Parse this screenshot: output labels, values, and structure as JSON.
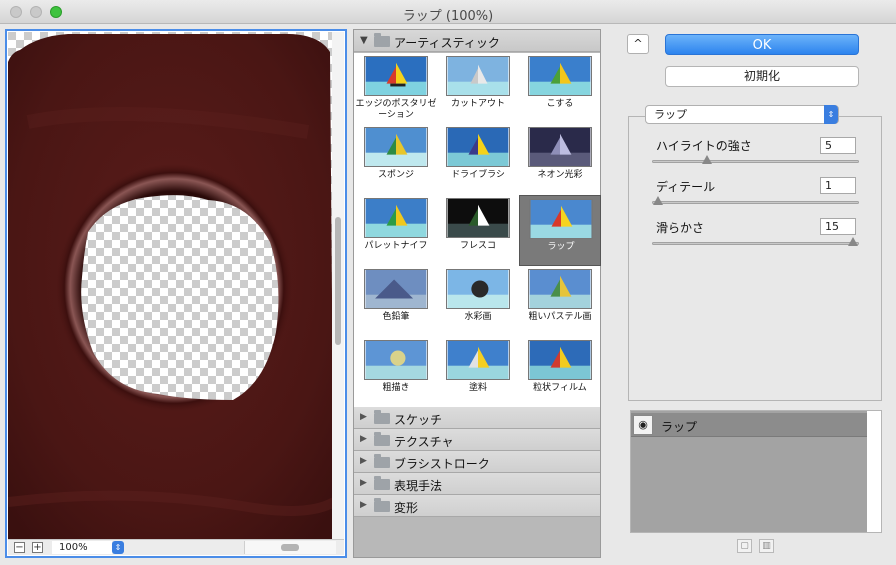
{
  "window": {
    "title": "ラップ (100%)"
  },
  "preview": {
    "zoom": "100%",
    "zoom_out": "−",
    "zoom_in": "+"
  },
  "gallery": {
    "open_group": "アーティスティック",
    "filters": [
      [
        "エッジのポスタリゼーション",
        "カットアウト",
        "こする"
      ],
      [
        "スポンジ",
        "ドライブラシ",
        "ネオン光彩"
      ],
      [
        "パレットナイフ",
        "フレスコ",
        "ラップ"
      ],
      [
        "色鉛筆",
        "水彩画",
        "粗いパステル画"
      ],
      [
        "粗描き",
        "塗料",
        "粒状フィルム"
      ]
    ],
    "selected_filter": "ラップ",
    "collapsed_groups": [
      "スケッチ",
      "テクスチャ",
      "ブラシストローク",
      "表現手法",
      "変形"
    ]
  },
  "buttons": {
    "collapse": "^",
    "ok": "OK",
    "reset": "初期化"
  },
  "settings": {
    "filter_name": "ラップ",
    "params": [
      {
        "label": "ハイライトの強さ",
        "value": "5",
        "fraction": 0.25
      },
      {
        "label": "ディテール",
        "value": "1",
        "fraction": 0.0
      },
      {
        "label": "滑らかさ",
        "value": "15",
        "fraction": 1.0
      }
    ]
  },
  "layers": {
    "items": [
      "ラップ"
    ]
  },
  "colors": {
    "accent": "#2d84ee",
    "preview_bg": "#4a1614"
  }
}
